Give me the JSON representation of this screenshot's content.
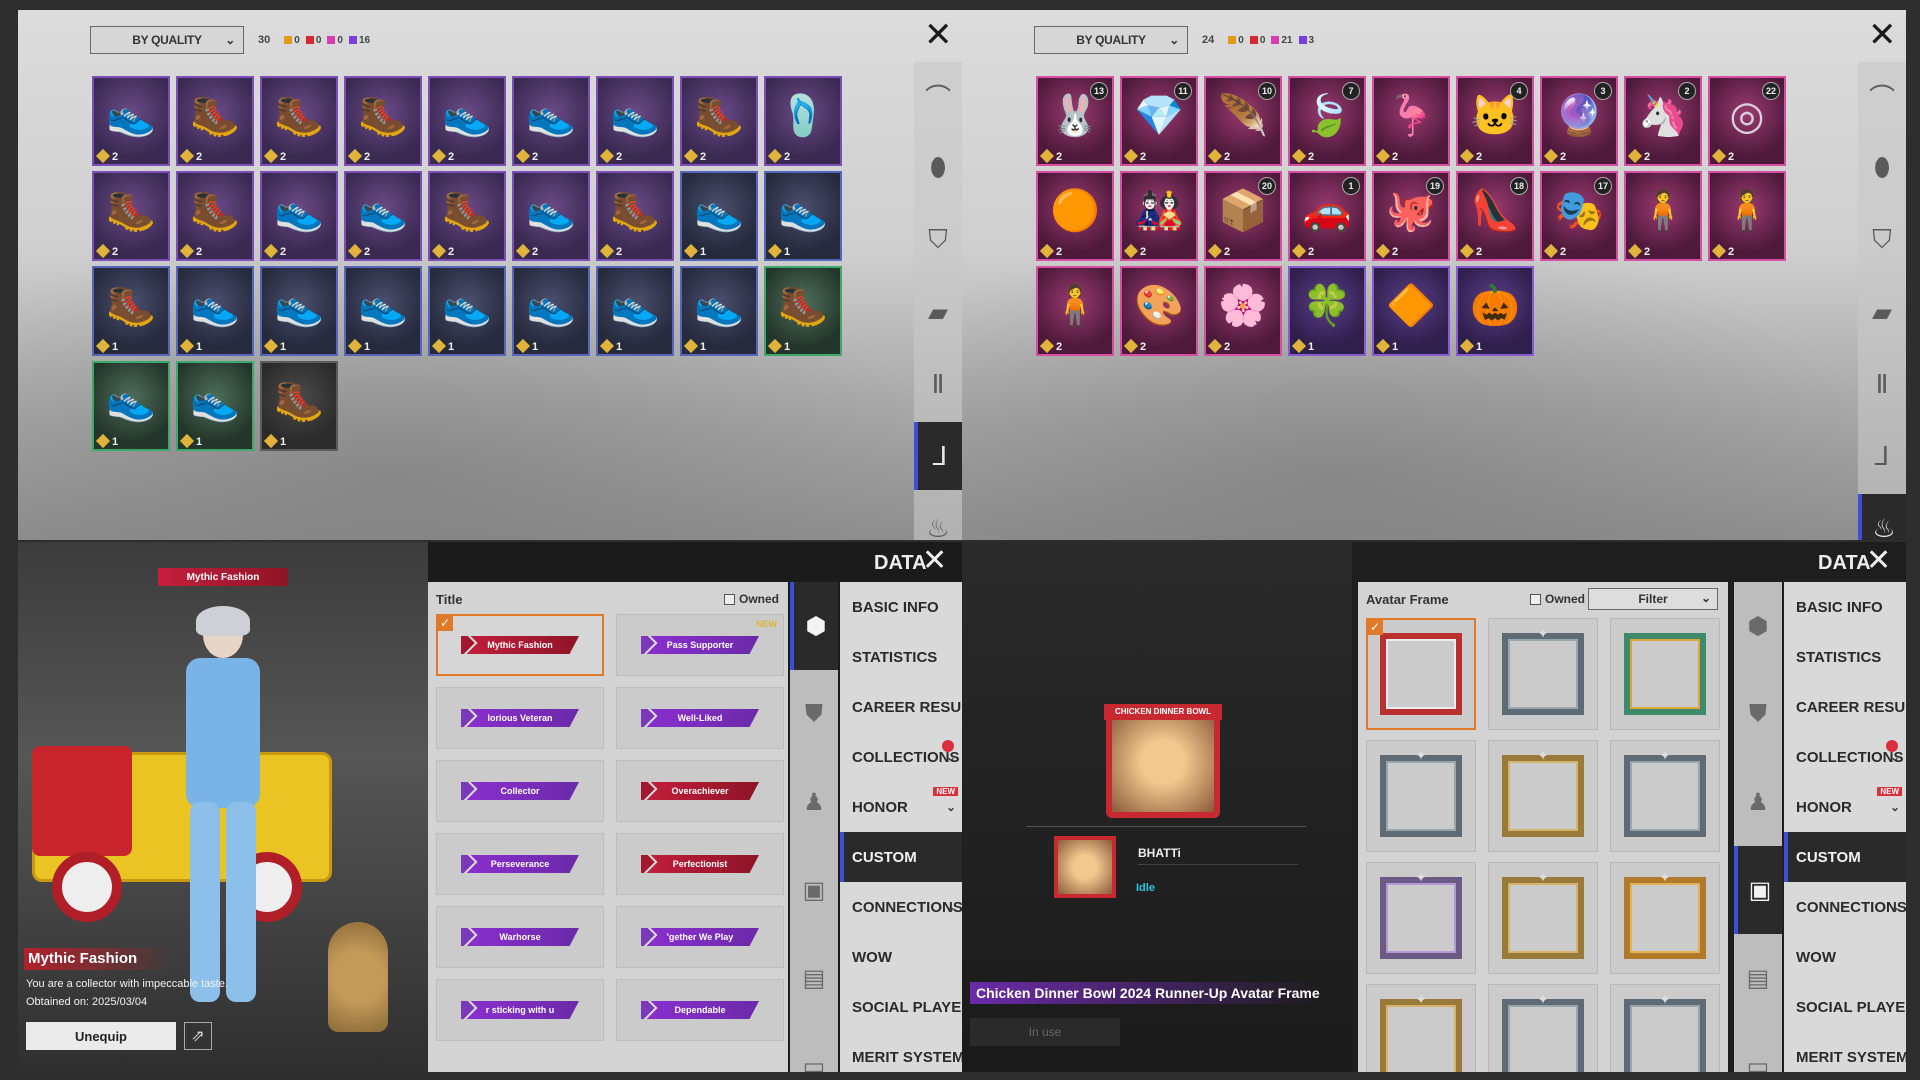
{
  "panel_shoes": {
    "sort_label": "BY QUALITY",
    "count": "30",
    "quality_counts": [
      {
        "color": "#e39a1c",
        "value": "0"
      },
      {
        "color": "#d62a32",
        "value": "0"
      },
      {
        "color": "#d93cb0",
        "value": "0"
      },
      {
        "color": "#7a3fd8",
        "value": "16"
      }
    ],
    "items": [
      {
        "q": "purple",
        "icon": "sneaker",
        "qty": "2"
      },
      {
        "q": "purple",
        "icon": "boot",
        "qty": "2"
      },
      {
        "q": "purple",
        "icon": "boot",
        "qty": "2"
      },
      {
        "q": "purple",
        "icon": "boot",
        "qty": "2"
      },
      {
        "q": "purple",
        "icon": "sneaker",
        "qty": "2"
      },
      {
        "q": "purple",
        "icon": "sneaker",
        "qty": "2"
      },
      {
        "q": "purple",
        "icon": "sneaker",
        "qty": "2"
      },
      {
        "q": "purple",
        "icon": "boot",
        "qty": "2"
      },
      {
        "q": "purple",
        "icon": "slipper",
        "qty": "2"
      },
      {
        "q": "purple",
        "icon": "boot",
        "qty": "2"
      },
      {
        "q": "purple",
        "icon": "boot",
        "qty": "2"
      },
      {
        "q": "purple",
        "icon": "sneaker",
        "qty": "2"
      },
      {
        "q": "purple",
        "icon": "sneaker",
        "qty": "2"
      },
      {
        "q": "purple",
        "icon": "boot",
        "qty": "2"
      },
      {
        "q": "purple",
        "icon": "sneaker",
        "qty": "2"
      },
      {
        "q": "purple",
        "icon": "boot",
        "qty": "2"
      },
      {
        "q": "blue",
        "icon": "sneaker",
        "qty": "1"
      },
      {
        "q": "blue",
        "icon": "sneaker",
        "qty": "1"
      },
      {
        "q": "blue",
        "icon": "boot",
        "qty": "1"
      },
      {
        "q": "blue",
        "icon": "sneaker",
        "qty": "1"
      },
      {
        "q": "blue",
        "icon": "sneaker",
        "qty": "1"
      },
      {
        "q": "blue",
        "icon": "sneaker",
        "qty": "1"
      },
      {
        "q": "blue",
        "icon": "sneaker",
        "qty": "1"
      },
      {
        "q": "blue",
        "icon": "sneaker",
        "qty": "1"
      },
      {
        "q": "blue",
        "icon": "sneaker",
        "qty": "1"
      },
      {
        "q": "blue",
        "icon": "sneaker",
        "qty": "1"
      },
      {
        "q": "green",
        "icon": "boot",
        "qty": "1"
      },
      {
        "q": "green",
        "icon": "sneaker",
        "qty": "1"
      },
      {
        "q": "green",
        "icon": "sneaker",
        "qty": "1"
      },
      {
        "q": "dark",
        "icon": "boot",
        "qty": "1"
      }
    ],
    "sidebar": [
      "glasses-icon",
      "mask-icon",
      "jacket-icon",
      "vest-icon",
      "pants-icon",
      "shoes-icon",
      "backpack-icon"
    ],
    "active_index": 5
  },
  "panel_pendants": {
    "sort_label": "BY QUALITY",
    "count": "24",
    "quality_counts": [
      {
        "color": "#e39a1c",
        "value": "0"
      },
      {
        "color": "#d62a32",
        "value": "0"
      },
      {
        "color": "#d93cb0",
        "value": "21"
      },
      {
        "color": "#7a3fd8",
        "value": "3"
      }
    ],
    "items": [
      {
        "q": "pink",
        "icon": "bunny",
        "qty": "2",
        "lvl": "13"
      },
      {
        "q": "pink",
        "icon": "gem",
        "qty": "2",
        "lvl": "11"
      },
      {
        "q": "pink",
        "icon": "feather",
        "qty": "2",
        "lvl": "10"
      },
      {
        "q": "pink",
        "icon": "leaf",
        "qty": "2",
        "lvl": "7"
      },
      {
        "q": "pink",
        "icon": "flamingo",
        "qty": "2",
        "lvl": ""
      },
      {
        "q": "pink",
        "icon": "cat",
        "qty": "2",
        "lvl": "4"
      },
      {
        "q": "pink",
        "icon": "orb",
        "qty": "2",
        "lvl": "3"
      },
      {
        "q": "pink",
        "icon": "unicorn",
        "qty": "2",
        "lvl": "2"
      },
      {
        "q": "pink",
        "icon": "ring",
        "qty": "2",
        "lvl": "22"
      },
      {
        "q": "pink",
        "icon": "ball",
        "qty": "2",
        "lvl": ""
      },
      {
        "q": "pink",
        "icon": "doll",
        "qty": "2",
        "lvl": ""
      },
      {
        "q": "pink",
        "icon": "box",
        "qty": "2",
        "lvl": "20"
      },
      {
        "q": "pink",
        "icon": "car",
        "qty": "2",
        "lvl": "1"
      },
      {
        "q": "pink",
        "icon": "octo",
        "qty": "2",
        "lvl": "19"
      },
      {
        "q": "pink",
        "icon": "shoe",
        "qty": "2",
        "lvl": "18"
      },
      {
        "q": "pink",
        "icon": "mask",
        "qty": "2",
        "lvl": "17"
      },
      {
        "q": "pink",
        "icon": "figure",
        "qty": "2",
        "lvl": ""
      },
      {
        "q": "pink",
        "icon": "figure",
        "qty": "2",
        "lvl": ""
      },
      {
        "q": "pink",
        "icon": "figure",
        "qty": "2",
        "lvl": ""
      },
      {
        "q": "pink",
        "icon": "paint",
        "qty": "2",
        "lvl": ""
      },
      {
        "q": "pink",
        "icon": "flower",
        "qty": "2",
        "lvl": ""
      },
      {
        "q": "pink2",
        "icon": "clover",
        "qty": "1",
        "lvl": ""
      },
      {
        "q": "pink2",
        "icon": "pendant",
        "qty": "1",
        "lvl": ""
      },
      {
        "q": "pink2",
        "icon": "pumpkin",
        "qty": "1",
        "lvl": ""
      }
    ],
    "sidebar": [
      "glasses-icon",
      "mask-icon",
      "jacket-icon",
      "vest-icon",
      "pants-icon",
      "shoes-icon",
      "pendant-icon"
    ],
    "active_index": 6
  },
  "panel_title": {
    "header": "DATA",
    "character_title": "Mythic Fashion",
    "info_title": "Mythic Fashion",
    "info_desc": "You are a collector with impeccable taste.",
    "obtained": "Obtained on: 2025/03/04",
    "unequip_label": "Unequip",
    "list_header": "Title",
    "owned_label": "Owned",
    "titles": [
      {
        "label": "Mythic Fashion",
        "color": "red",
        "selected": true,
        "new": false
      },
      {
        "label": "Pass Supporter",
        "color": "purple",
        "selected": false,
        "new": true
      },
      {
        "label": "Iorious Veteran",
        "color": "purple",
        "selected": false,
        "new": false
      },
      {
        "label": "Well-Liked",
        "color": "purple",
        "selected": false,
        "new": false
      },
      {
        "label": "Collector",
        "color": "purple",
        "selected": false,
        "new": false
      },
      {
        "label": "Overachiever",
        "color": "red",
        "selected": false,
        "new": false
      },
      {
        "label": "Perseverance",
        "color": "purple",
        "selected": false,
        "new": false
      },
      {
        "label": "Perfectionist",
        "color": "red",
        "selected": false,
        "new": false
      },
      {
        "label": "Warhorse",
        "color": "purple",
        "selected": false,
        "new": false
      },
      {
        "label": "'gether We Play",
        "color": "purple",
        "selected": false,
        "new": false
      },
      {
        "label": "r sticking with u",
        "color": "purple",
        "selected": false,
        "new": false
      },
      {
        "label": "Dependable",
        "color": "purple",
        "selected": false,
        "new": false
      }
    ],
    "new_tag": "NEW",
    "menu": [
      "BASIC INFO",
      "STATISTICS",
      "CAREER RESULTS",
      "COLLECTIONS",
      "HONOR",
      "CUSTOM",
      "CONNECTIONS",
      "WOW",
      "SOCIAL PLAYER CAI",
      "MERIT SYSTEM"
    ]
  },
  "panel_frame": {
    "header": "DATA",
    "list_header": "Avatar Frame",
    "owned_label": "Owned",
    "filter_label": "Filter",
    "avatar_banner": "CHICKEN DINNER BOWL",
    "player_name": "BHATTi",
    "status": "Idle",
    "frame_name": "Chicken Dinner Bowl 2024 Runner-Up Avatar Frame",
    "in_use": "In use",
    "frames": [
      "red",
      "silver",
      "green",
      "silver",
      "gold",
      "silver",
      "purple",
      "gold",
      "bronze",
      "gold",
      "silver",
      "silver"
    ],
    "menu": [
      "BASIC INFO",
      "STATISTICS",
      "CAREER RESULTS",
      "COLLECTIONS",
      "HONOR",
      "CUSTOM",
      "CONNECTIONS",
      "WOW",
      "SOCIAL PLAYER CARI",
      "MERIT SYSTEM"
    ]
  },
  "menu_badges": {
    "new_label": "NEW"
  }
}
